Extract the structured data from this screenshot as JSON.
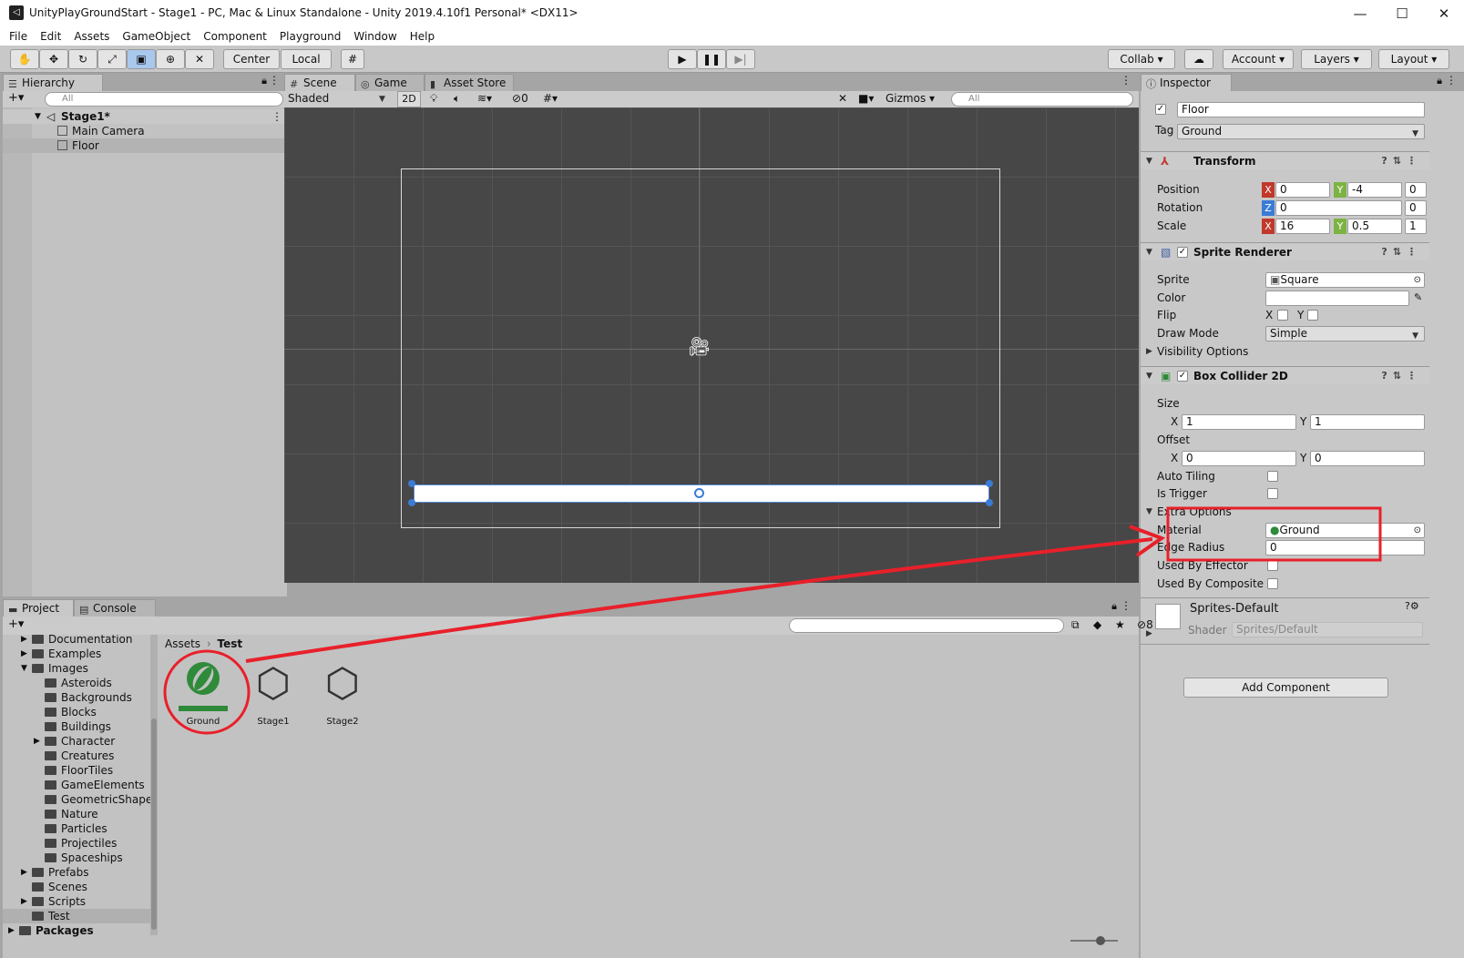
{
  "window": {
    "title": "UnityPlayGroundStart - Stage1 - PC, Mac & Linux Standalone - Unity 2019.4.10f1 Personal* <DX11>",
    "minimize": "—",
    "maximize": "☐",
    "close": "✕"
  },
  "menu": [
    "File",
    "Edit",
    "Assets",
    "GameObject",
    "Component",
    "Playground",
    "Window",
    "Help"
  ],
  "toolbar": {
    "pivot": "Center",
    "space": "Local",
    "collab": "Collab",
    "account": "Account",
    "layers": "Layers",
    "layout": "Layout"
  },
  "hierarchy": {
    "tab": "Hierarchy",
    "search_placeholder": "All",
    "scene": "Stage1*",
    "items": [
      "Main Camera",
      "Floor"
    ]
  },
  "scene_view": {
    "tabs": [
      "Scene",
      "Game",
      "Asset Store"
    ],
    "shading": "Shaded",
    "mode_2d": "2D",
    "hidden_count": "0",
    "gizmos": "Gizmos",
    "search_placeholder": "All"
  },
  "inspector": {
    "tab": "Inspector",
    "object_name": "Floor",
    "tag_label": "Tag",
    "tag": "Ground",
    "transform": {
      "title": "Transform",
      "position_label": "Position",
      "position": {
        "x": "0",
        "y": "-4",
        "z": "0"
      },
      "rotation_label": "Rotation",
      "rotation": {
        "z_label": "Z",
        "z": "0",
        "extra": "0"
      },
      "scale_label": "Scale",
      "scale": {
        "x": "16",
        "y": "0.5",
        "z": "1"
      }
    },
    "sprite_renderer": {
      "title": "Sprite Renderer",
      "sprite_label": "Sprite",
      "sprite": "Square",
      "color_label": "Color",
      "flip_label": "Flip",
      "flip_x": "X",
      "flip_y": "Y",
      "draw_mode_label": "Draw Mode",
      "draw_mode": "Simple",
      "visibility": "Visibility Options"
    },
    "box_collider": {
      "title": "Box Collider 2D",
      "size_label": "Size",
      "size": {
        "x": "1",
        "y": "1"
      },
      "offset_label": "Offset",
      "offset": {
        "x": "0",
        "y": "0"
      },
      "auto_tiling": "Auto Tiling",
      "is_trigger": "Is Trigger",
      "extra_options": "Extra Options",
      "material_label": "Material",
      "material": "Ground",
      "edge_radius_label": "Edge Radius",
      "edge_radius": "0",
      "used_by_effector": "Used By Effector",
      "used_by_composite": "Used By Composite"
    },
    "material": {
      "name": "Sprites-Default",
      "shader_label": "Shader",
      "shader": "Sprites/Default"
    },
    "add_component": "Add Component"
  },
  "project": {
    "tabs": [
      "Project",
      "Console"
    ],
    "hidden_count": "8",
    "breadcrumb": [
      "Assets",
      "Test"
    ],
    "tree": [
      {
        "label": "Documentation",
        "indent": 1,
        "arrow": "▶"
      },
      {
        "label": "Examples",
        "indent": 1,
        "arrow": "▶"
      },
      {
        "label": "Images",
        "indent": 1,
        "arrow": "▼"
      },
      {
        "label": "Asteroids",
        "indent": 2,
        "arrow": ""
      },
      {
        "label": "Backgrounds",
        "indent": 2,
        "arrow": ""
      },
      {
        "label": "Blocks",
        "indent": 2,
        "arrow": ""
      },
      {
        "label": "Buildings",
        "indent": 2,
        "arrow": ""
      },
      {
        "label": "Character",
        "indent": 2,
        "arrow": "▶"
      },
      {
        "label": "Creatures",
        "indent": 2,
        "arrow": ""
      },
      {
        "label": "FloorTiles",
        "indent": 2,
        "arrow": ""
      },
      {
        "label": "GameElements",
        "indent": 2,
        "arrow": ""
      },
      {
        "label": "GeometricShapes",
        "indent": 2,
        "arrow": ""
      },
      {
        "label": "Nature",
        "indent": 2,
        "arrow": ""
      },
      {
        "label": "Particles",
        "indent": 2,
        "arrow": ""
      },
      {
        "label": "Projectiles",
        "indent": 2,
        "arrow": ""
      },
      {
        "label": "Spaceships",
        "indent": 2,
        "arrow": ""
      },
      {
        "label": "Prefabs",
        "indent": 1,
        "arrow": "▶"
      },
      {
        "label": "Scenes",
        "indent": 1,
        "arrow": ""
      },
      {
        "label": "Scripts",
        "indent": 1,
        "arrow": "▶"
      },
      {
        "label": "Test",
        "indent": 1,
        "arrow": ""
      },
      {
        "label": "Packages",
        "indent": 0,
        "arrow": "▶"
      }
    ],
    "assets": [
      "Ground",
      "Stage1",
      "Stage2"
    ]
  },
  "colors": {
    "annotation": "#e8202a",
    "ground_green": "#2f8a3a",
    "x_axis": "#c0392b",
    "y_axis": "#7cb342",
    "z_axis": "#3a7bd5"
  }
}
